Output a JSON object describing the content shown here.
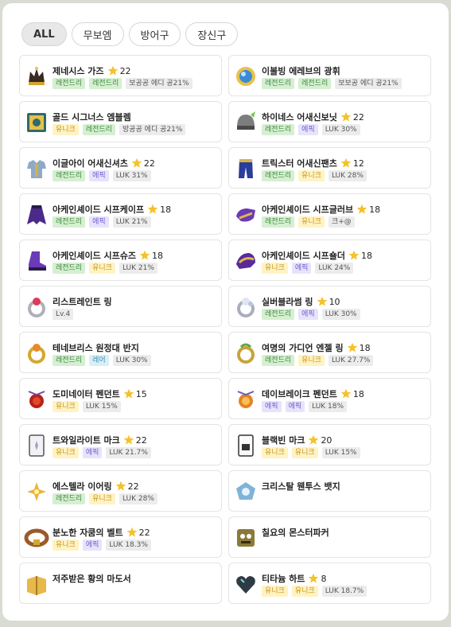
{
  "tabs": [
    {
      "label": "ALL",
      "active": true
    },
    {
      "label": "무보엠",
      "active": false
    },
    {
      "label": "방어구",
      "active": false
    },
    {
      "label": "장신구",
      "active": false
    }
  ],
  "colors": {
    "legendary": "#3c8a3a",
    "unique": "#c7961a",
    "epic": "#6c5fd0",
    "rare": "#3d8fb0",
    "star": "#f5c22b"
  },
  "items": [
    {
      "name": "제네시스 가즈",
      "stars": "22",
      "icon": "dark-crown-icon",
      "badges": [
        {
          "text": "레전드리",
          "type": "legend"
        },
        {
          "text": "레전드리",
          "type": "legend"
        },
        {
          "text": "보공공 에디 공21%",
          "type": "stat"
        }
      ]
    },
    {
      "name": "이볼빙 에레브의 광휘",
      "stars": "",
      "icon": "blue-orb-emblem-icon",
      "badges": [
        {
          "text": "레전드리",
          "type": "legend"
        },
        {
          "text": "레전드리",
          "type": "legend"
        },
        {
          "text": "보보공 에디 공21%",
          "type": "stat"
        }
      ]
    },
    {
      "name": "골드 시그너스 엠블렘",
      "stars": "",
      "icon": "gold-emblem-icon",
      "badges": [
        {
          "text": "유니크",
          "type": "unique"
        },
        {
          "text": "레전드리",
          "type": "legend"
        },
        {
          "text": "방공공 에디 공21%",
          "type": "stat"
        }
      ]
    },
    {
      "name": "하이네스 어새신보닛",
      "stars": "22",
      "icon": "helmet-icon",
      "badges": [
        {
          "text": "레전드리",
          "type": "legend"
        },
        {
          "text": "에픽",
          "type": "epic"
        },
        {
          "text": "LUK 30%",
          "type": "stat"
        }
      ]
    },
    {
      "name": "이글아이 어새신셔츠",
      "stars": "22",
      "icon": "shirt-icon",
      "badges": [
        {
          "text": "레전드리",
          "type": "legend"
        },
        {
          "text": "에픽",
          "type": "epic"
        },
        {
          "text": "LUK 31%",
          "type": "stat"
        }
      ]
    },
    {
      "name": "트릭스터 어새신팬츠",
      "stars": "12",
      "icon": "pants-icon",
      "badges": [
        {
          "text": "레전드리",
          "type": "legend"
        },
        {
          "text": "유니크",
          "type": "unique"
        },
        {
          "text": "LUK 28%",
          "type": "stat"
        }
      ]
    },
    {
      "name": "아케인셰이드 시프케이프",
      "stars": "18",
      "icon": "cape-icon",
      "badges": [
        {
          "text": "레전드리",
          "type": "legend"
        },
        {
          "text": "에픽",
          "type": "epic"
        },
        {
          "text": "LUK 21%",
          "type": "stat"
        }
      ]
    },
    {
      "name": "아케인셰이드 시프글러브",
      "stars": "18",
      "icon": "glove-icon",
      "badges": [
        {
          "text": "레전드리",
          "type": "legend"
        },
        {
          "text": "유니크",
          "type": "unique"
        },
        {
          "text": "크+@",
          "type": "stat"
        }
      ]
    },
    {
      "name": "아케인셰이드 시프슈즈",
      "stars": "18",
      "icon": "shoes-icon",
      "badges": [
        {
          "text": "레전드리",
          "type": "legend"
        },
        {
          "text": "유니크",
          "type": "unique"
        },
        {
          "text": "LUK 21%",
          "type": "stat"
        }
      ]
    },
    {
      "name": "아케인셰이드 시프숄더",
      "stars": "18",
      "icon": "shoulder-icon",
      "badges": [
        {
          "text": "유니크",
          "type": "unique"
        },
        {
          "text": "에픽",
          "type": "epic"
        },
        {
          "text": "LUK 24%",
          "type": "stat"
        }
      ]
    },
    {
      "name": "리스트레인트 링",
      "stars": "",
      "icon": "ring-icon",
      "badges": [
        {
          "text": "Lv.4",
          "type": "stat"
        }
      ]
    },
    {
      "name": "실버블라썸 링",
      "stars": "10",
      "icon": "silver-ring-icon",
      "badges": [
        {
          "text": "레전드리",
          "type": "legend"
        },
        {
          "text": "에픽",
          "type": "epic"
        },
        {
          "text": "LUK 30%",
          "type": "stat"
        }
      ]
    },
    {
      "name": "테네브리스 원정대 반지",
      "stars": "",
      "icon": "gold-ring-icon",
      "badges": [
        {
          "text": "레전드리",
          "type": "legend"
        },
        {
          "text": "레어",
          "type": "rare"
        },
        {
          "text": "LUK 30%",
          "type": "stat"
        }
      ]
    },
    {
      "name": "여명의 가디언 엔젤 링",
      "stars": "18",
      "icon": "green-ring-icon",
      "badges": [
        {
          "text": "레전드리",
          "type": "legend"
        },
        {
          "text": "유니크",
          "type": "unique"
        },
        {
          "text": "LUK 27.7%",
          "type": "stat"
        }
      ]
    },
    {
      "name": "도미네이터 펜던트",
      "stars": "15",
      "icon": "red-pendant-icon",
      "badges": [
        {
          "text": "유니크",
          "type": "unique"
        },
        {
          "text": "LUK 15%",
          "type": "stat"
        }
      ]
    },
    {
      "name": "데이브레이크 펜던트",
      "stars": "18",
      "icon": "orange-pendant-icon",
      "badges": [
        {
          "text": "에픽",
          "type": "epic"
        },
        {
          "text": "에픽",
          "type": "epic"
        },
        {
          "text": "LUK 18%",
          "type": "stat"
        }
      ]
    },
    {
      "name": "트와일라이트 마크",
      "stars": "22",
      "icon": "card-mark-icon",
      "badges": [
        {
          "text": "유니크",
          "type": "unique"
        },
        {
          "text": "에픽",
          "type": "epic"
        },
        {
          "text": "LUK 21.7%",
          "type": "stat"
        }
      ]
    },
    {
      "name": "블랙빈 마크",
      "stars": "20",
      "icon": "black-mark-icon",
      "badges": [
        {
          "text": "유니크",
          "type": "unique"
        },
        {
          "text": "유니크",
          "type": "unique"
        },
        {
          "text": "LUK 15%",
          "type": "stat"
        }
      ]
    },
    {
      "name": "에스텔라 이어링",
      "stars": "22",
      "icon": "earring-icon",
      "badges": [
        {
          "text": "레전드리",
          "type": "legend"
        },
        {
          "text": "유니크",
          "type": "unique"
        },
        {
          "text": "LUK 28%",
          "type": "stat"
        }
      ]
    },
    {
      "name": "크리스탈 웬투스 뱃지",
      "stars": "",
      "icon": "badge-icon",
      "badges": []
    },
    {
      "name": "분노한 자쿰의 벨트",
      "stars": "22",
      "icon": "belt-icon",
      "badges": [
        {
          "text": "유니크",
          "type": "unique"
        },
        {
          "text": "에픽",
          "type": "epic"
        },
        {
          "text": "LUK 18.3%",
          "type": "stat"
        }
      ]
    },
    {
      "name": "칠요의 몬스터파커",
      "stars": "",
      "icon": "monster-parker-icon",
      "badges": []
    },
    {
      "name": "저주받은 황의 마도서",
      "stars": "",
      "icon": "spellbook-icon",
      "badges": []
    },
    {
      "name": "티타늄 하트",
      "stars": "8",
      "icon": "heart-icon",
      "badges": [
        {
          "text": "유니크",
          "type": "unique"
        },
        {
          "text": "유니크",
          "type": "unique"
        },
        {
          "text": "LUK 18.7%",
          "type": "stat"
        }
      ]
    }
  ]
}
